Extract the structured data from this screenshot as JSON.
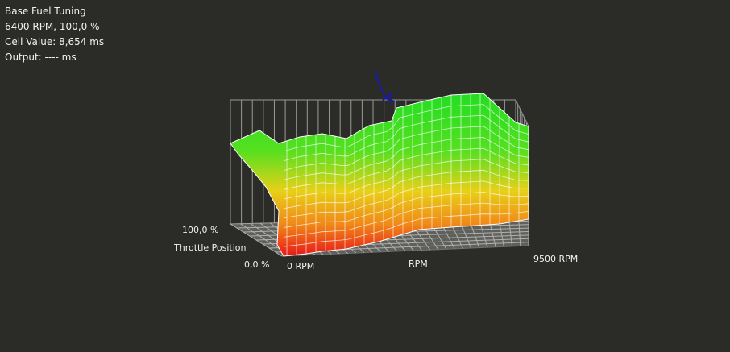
{
  "info": {
    "title": "Base Fuel Tuning",
    "cursor": "6400 RPM, 100,0 %",
    "cell_value": "Cell Value: 8,654 ms",
    "output": "Output: ---- ms"
  },
  "axes": {
    "throttle_max": "100,0 %",
    "throttle_label": "Throttle Position",
    "throttle_min": "0,0 %",
    "rpm_min": "0 RPM",
    "rpm_label": "RPM",
    "rpm_max": "9500 RPM"
  },
  "colors": {
    "background": "#2b2b27",
    "grid": "#9a9a96",
    "mesh": "#ffffff",
    "cursor": "#1a1aa8",
    "high": "#22dd22",
    "mid": "#f0c010",
    "low": "#e81818"
  }
}
